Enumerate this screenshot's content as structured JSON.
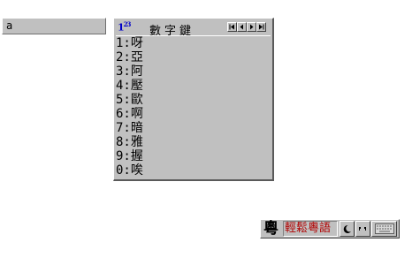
{
  "composition": {
    "text": "a"
  },
  "candidate_window": {
    "logo": "1",
    "logo_sup": "23",
    "title": "數字鍵",
    "nav": [
      "first-page",
      "previous",
      "next",
      "last-page"
    ],
    "candidates": [
      "1:呀",
      "2:亞",
      "3:阿",
      "4:壓",
      "5:歐",
      "6:啊",
      "7:暗",
      "8:雅",
      "9:握",
      "0:唉"
    ]
  },
  "ime_status_bar": {
    "icon_char": "粵",
    "ime_name": "輕鬆粵語",
    "buttons": [
      "half-full-width-moon-icon",
      "punctuation-icon",
      "soft-keyboard-icon"
    ],
    "colors": {
      "ime_name": "#b00000",
      "logo": "#0000c8",
      "face": "#c0c0c0"
    }
  }
}
